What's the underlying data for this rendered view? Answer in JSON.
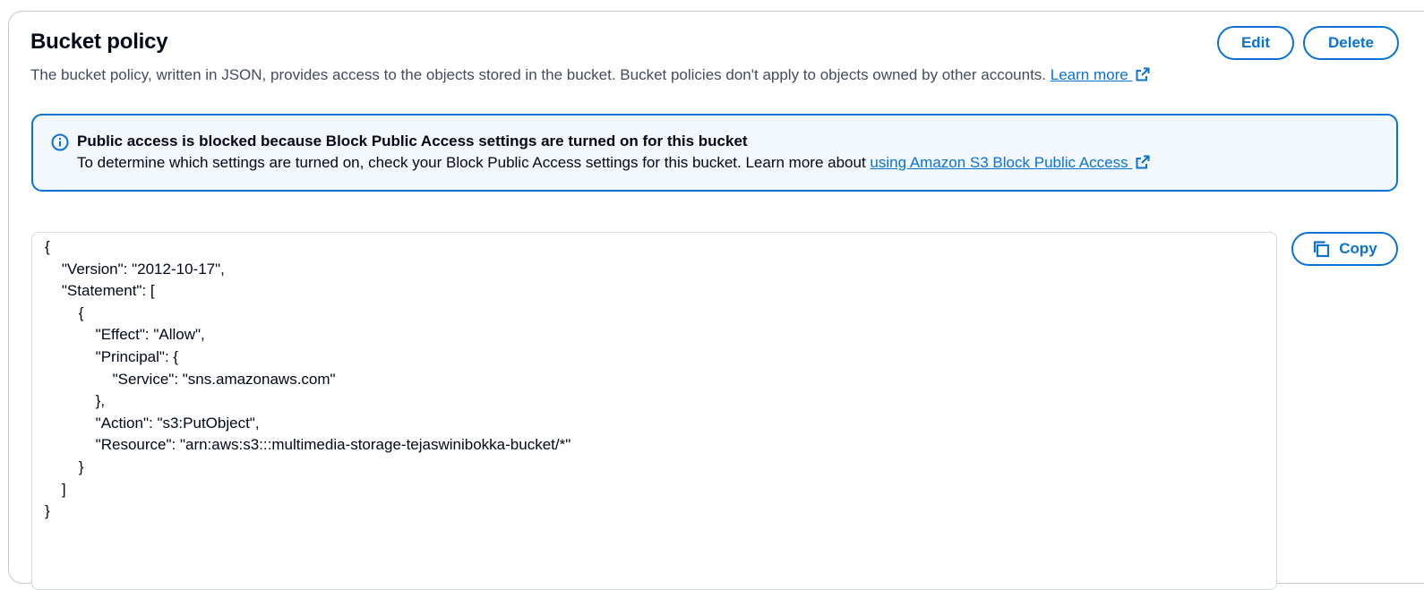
{
  "header": {
    "title": "Bucket policy",
    "description": "The bucket policy, written in JSON, provides access to the objects stored in the bucket. Bucket policies don't apply to objects owned by other accounts.",
    "learn_more": "Learn more",
    "edit_label": "Edit",
    "delete_label": "Delete"
  },
  "alert": {
    "type": "info",
    "title": "Public access is blocked because Block Public Access settings are turned on for this bucket",
    "body": "To determine which settings are turned on, check your Block Public Access settings for this bucket. Learn more about",
    "link": "using Amazon S3 Block Public Access"
  },
  "policy": {
    "copy_label": "Copy",
    "code": "{\n    \"Version\": \"2012-10-17\",\n    \"Statement\": [\n        {\n            \"Effect\": \"Allow\",\n            \"Principal\": {\n                \"Service\": \"sns.amazonaws.com\"\n            },\n            \"Action\": \"s3:PutObject\",\n            \"Resource\": \"arn:aws:s3:::multimedia-storage-tejaswinibokka-bucket/*\"\n        }\n    ]\n}"
  },
  "icons": {
    "external_link": "external-link-icon",
    "info": "info-icon",
    "copy": "copy-icon"
  },
  "colors": {
    "accent": "#0972d3",
    "alert_background": "#f2f8fd",
    "text": "#000716",
    "secondary_text": "#414d5c"
  }
}
